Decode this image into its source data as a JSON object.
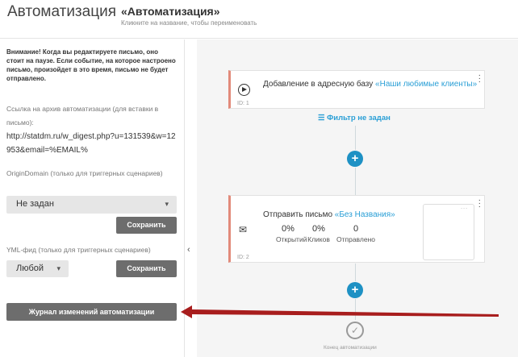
{
  "header": {
    "app_title": "Автоматизация",
    "automation_name": "«Автоматизация»",
    "rename_hint": "Кликните на название, чтобы переименовать"
  },
  "sidebar": {
    "warning": "Внимание! Когда вы редактируете письмо, оно стоит на паузе. Если событие, на которое настроено письмо, произойдет в это время, письмо не будет отправлено.",
    "archive_label": "Ссылка на архив автоматизации (для вставки в письмо):",
    "archive_link": "http://statdm.ru/w_digest.php?u=131539&w=12953&email=%EMAIL%",
    "origin_label": "OriginDomain (только для триггерных сценариев)",
    "origin_value": "Не задан",
    "save_label": "Сохранить",
    "yml_label": "YML-фид (только для триггерных сценариев)",
    "yml_value": "Любой",
    "journal_label": "Журнал изменений автоматизации",
    "collapse_glyph": "‹"
  },
  "canvas": {
    "card1": {
      "prefix": "Добавление в адресную базу ",
      "link": "«Наши любимые клиенты»",
      "id": "ID: 1"
    },
    "filter": "Фильтр не задан",
    "card2": {
      "prefix": "Отправить письмо ",
      "link": "«Без Названия»",
      "id": "ID: 2",
      "stats": [
        {
          "value": "0%",
          "label": "Открытий"
        },
        {
          "value": "0%",
          "label": "Кликов"
        },
        {
          "value": "0",
          "label": "Отправлено"
        }
      ]
    },
    "plus": "+",
    "end_label": "Конец автоматизации"
  },
  "colors": {
    "accent": "#1e91c4",
    "link": "#2a9fd6",
    "card_border": "#e28a7a",
    "annotation_arrow": "#a81d1d"
  },
  "icons": [
    "play-icon",
    "mail-icon",
    "filter-icon",
    "plus-icon",
    "check-circle-icon",
    "kebab-menu-icon",
    "chevron-down-icon"
  ]
}
